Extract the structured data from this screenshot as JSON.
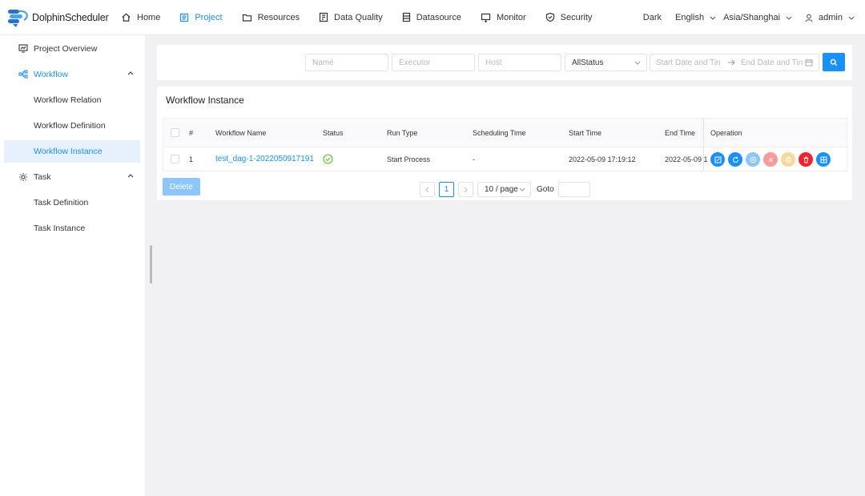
{
  "app": {
    "name": "DolphinScheduler"
  },
  "nav": [
    {
      "label": "Home",
      "icon": "home-icon",
      "active": false
    },
    {
      "label": "Project",
      "icon": "project-icon",
      "active": true
    },
    {
      "label": "Resources",
      "icon": "folder-icon",
      "active": false
    },
    {
      "label": "Data Quality",
      "icon": "data-quality-icon",
      "active": false
    },
    {
      "label": "Datasource",
      "icon": "datasource-icon",
      "active": false
    },
    {
      "label": "Monitor",
      "icon": "monitor-icon",
      "active": false
    },
    {
      "label": "Security",
      "icon": "shield-icon",
      "active": false
    }
  ],
  "header_tools": {
    "theme": "Dark",
    "language": "English",
    "timezone": "Asia/Shanghai",
    "user": "admin"
  },
  "sidebar": {
    "items": [
      {
        "label": "Project Overview",
        "icon": "overview-icon"
      },
      {
        "label": "Workflow",
        "icon": "workflow-icon",
        "expanded": true
      },
      {
        "label": "Workflow Relation"
      },
      {
        "label": "Workflow Definition"
      },
      {
        "label": "Workflow Instance",
        "selected": true
      },
      {
        "label": "Task",
        "icon": "gear-icon",
        "expanded": true
      },
      {
        "label": "Task Definition"
      },
      {
        "label": "Task Instance"
      }
    ]
  },
  "filters": {
    "name_placeholder": "Name",
    "executor_placeholder": "Executor",
    "host_placeholder": "Host",
    "status_value": "AllStatus",
    "start_date_placeholder": "Start Date and Tin",
    "end_date_placeholder": "End Date and Tin"
  },
  "instance_table": {
    "title": "Workflow Instance",
    "columns": [
      "#",
      "Workflow Name",
      "Status",
      "Run Type",
      "Scheduling Time",
      "Start Time",
      "End Time",
      "Operation"
    ],
    "rows": [
      {
        "index": "1",
        "name": "test_dag-1-2022050917191",
        "status": "success",
        "run_type": "Start Process",
        "scheduling_time": "-",
        "start_time": "2022-05-09 17:19:12",
        "end_time": "2022-05-09 1"
      }
    ],
    "operations": [
      {
        "name": "edit-button",
        "icon": "edit-icon",
        "color": "#1890ff"
      },
      {
        "name": "rerun-button",
        "icon": "rerun-icon",
        "color": "#1890ff"
      },
      {
        "name": "recover-failed-button",
        "icon": "recover-icon",
        "color": "#8cc5ff"
      },
      {
        "name": "stop-button",
        "icon": "stop-icon",
        "color": "#ff9a9a"
      },
      {
        "name": "pause-button",
        "icon": "pause-icon",
        "color": "#fbd89a"
      },
      {
        "name": "delete-row-button",
        "icon": "trash-icon",
        "color": "#f5222d"
      },
      {
        "name": "gantt-button",
        "icon": "gantt-icon",
        "color": "#1890ff"
      }
    ]
  },
  "actions": {
    "delete_label": "Delete"
  },
  "pagination": {
    "current_page": "1",
    "page_size": "10 / page",
    "goto_label": "Goto"
  },
  "colors": {
    "primary": "#1890ff",
    "success": "#52c41a",
    "background": "#f1f1f4"
  }
}
